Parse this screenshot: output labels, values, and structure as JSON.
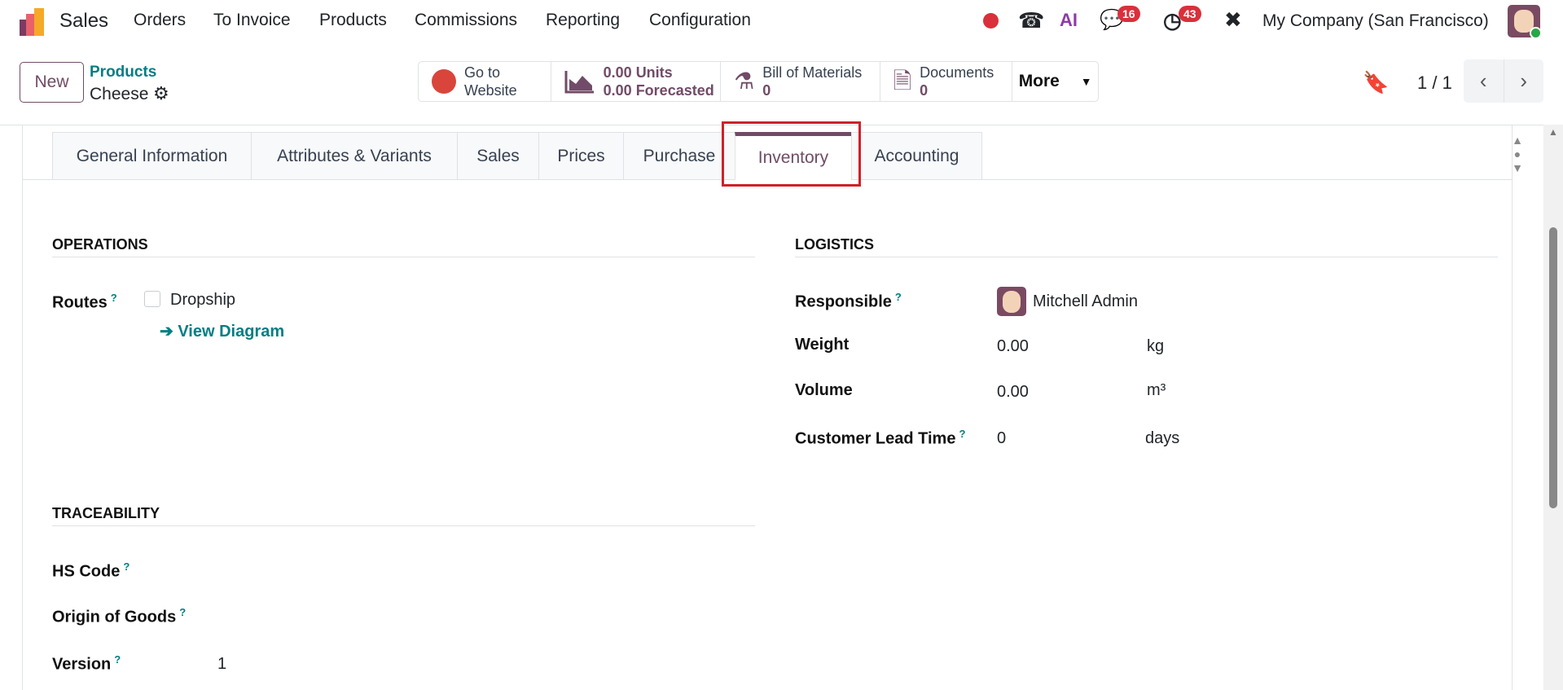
{
  "nav": {
    "app": "Sales",
    "menu": [
      "Orders",
      "To Invoice",
      "Products",
      "Commissions",
      "Reporting",
      "Configuration"
    ],
    "messages_badge": "16",
    "activities_badge": "43",
    "ai_label": "AI",
    "company": "My Company (San Francisco)"
  },
  "control": {
    "new_label": "New",
    "breadcrumb_parent": "Products",
    "record": "Cheese",
    "stats": {
      "website_l1": "Go to",
      "website_l2": "Website",
      "units_val": "0.00",
      "units_lbl": "Units",
      "forecast_val": "0.00",
      "forecast_lbl": "Forecasted",
      "bom_lbl": "Bill of Materials",
      "bom_val": "0",
      "docs_lbl": "Documents",
      "docs_val": "0",
      "more": "More"
    },
    "pager": "1 / 1"
  },
  "tabs": [
    "General Information",
    "Attributes & Variants",
    "Sales",
    "Prices",
    "Purchase",
    "Inventory",
    "Accounting"
  ],
  "active_tab": "Inventory",
  "operations": {
    "title": "OPERATIONS",
    "routes_label": "Routes",
    "route_option": "Dropship",
    "route_checked": false,
    "view_diagram": "View Diagram"
  },
  "logistics": {
    "title": "LOGISTICS",
    "responsible_label": "Responsible",
    "responsible": "Mitchell Admin",
    "weight_label": "Weight",
    "weight": "0.00",
    "weight_unit": "kg",
    "volume_label": "Volume",
    "volume": "0.00",
    "volume_unit": "m³",
    "lead_label": "Customer Lead Time",
    "lead": "0",
    "lead_unit": "days"
  },
  "traceability": {
    "title": "TRACEABILITY",
    "hs_label": "HS Code",
    "origin_label": "Origin of Goods",
    "version_label": "Version",
    "version": "1"
  },
  "help_mark": "?",
  "colors": {
    "brand": "#714b67",
    "link": "#017e84",
    "badge": "#d9303b",
    "highlight": "#d0202a"
  }
}
